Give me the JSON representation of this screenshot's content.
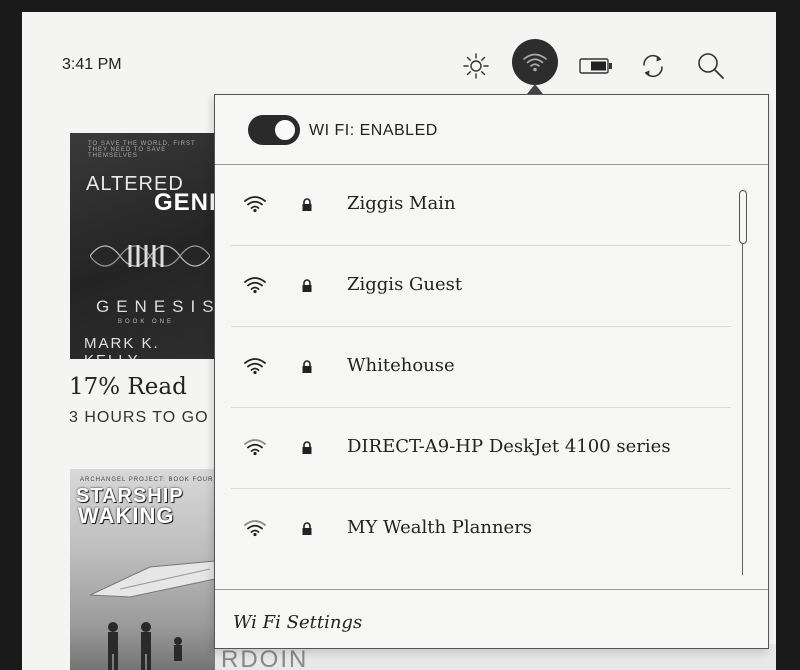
{
  "status_bar": {
    "time": "3:41 PM",
    "icons": [
      "brightness-icon",
      "wifi-icon",
      "battery-icon",
      "sync-icon",
      "search-icon"
    ]
  },
  "library": {
    "book1": {
      "cover_tagline": "TO SAVE THE WORLD, FIRST THEY NEED TO SAVE THEMSELVES",
      "cover_title_1": "ALTERED",
      "cover_title_2": "GENES",
      "cover_series": "GENESIS",
      "cover_book_no": "BOOK ONE",
      "cover_author": "MARK K. KELLY",
      "progress": "17% Read",
      "time_left": "3 HOURS TO GO"
    },
    "book2": {
      "cover_tagline": "ARCHANGEL PROJECT: BOOK FOUR",
      "cover_title_1": "STARSHIP",
      "cover_title_2": "WAKING"
    },
    "bottom_partial_text": "RDOIN"
  },
  "wifi_panel": {
    "toggle_label": "WI FI: ENABLED",
    "enabled": true,
    "networks": [
      {
        "name": "Ziggis Main",
        "secured": true,
        "signal": 4
      },
      {
        "name": "Ziggis Guest",
        "secured": true,
        "signal": 4
      },
      {
        "name": "Whitehouse",
        "secured": true,
        "signal": 4
      },
      {
        "name": "DIRECT-A9-HP DeskJet 4100 series",
        "secured": true,
        "signal": 3
      },
      {
        "name": "MY Wealth Planners",
        "secured": true,
        "signal": 3
      }
    ],
    "settings_link": "Wi Fi Settings"
  },
  "colors": {
    "screen_bg": "#f4f4f2",
    "accent_dark": "#2d2d2d"
  }
}
